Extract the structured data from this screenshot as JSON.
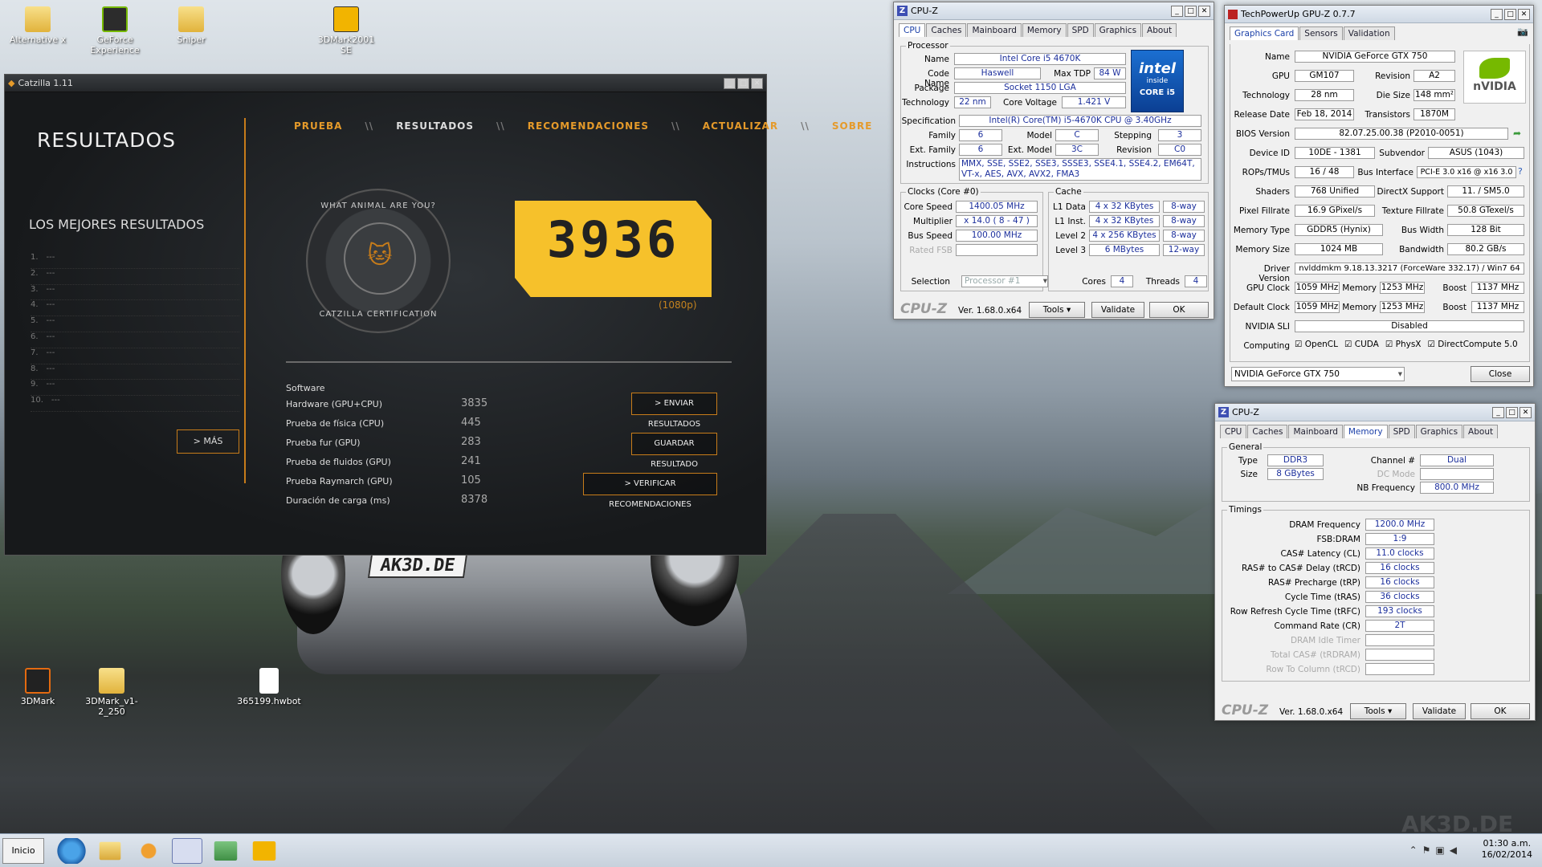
{
  "desktop": {
    "icons": [
      {
        "label": "Alternative x"
      },
      {
        "label": "GeForce Experience"
      },
      {
        "label": "Sniper"
      },
      {
        "label": "3DMark2001 SE"
      },
      {
        "label": "3DMark"
      },
      {
        "label": "3DMark_v1-2_250"
      },
      {
        "label": "365199.hwbot"
      }
    ],
    "plate": "AK3D.DE",
    "watermark": "AK3D.DE"
  },
  "catzilla": {
    "title": "Catzilla 1.11",
    "nav": [
      "PRUEBA",
      "RESULTADOS",
      "RECOMENDACIONES",
      "ACTUALIZAR",
      "SOBRE"
    ],
    "nav_sep": "\\\\",
    "heading": "RESULTADOS",
    "best": "LOS MEJORES RESULTADOS",
    "list": [
      "1.",
      "2.",
      "3.",
      "4.",
      "5.",
      "6.",
      "7.",
      "8.",
      "9.",
      "10."
    ],
    "list_empty": "---",
    "more": "> MÁS",
    "badge_top": "WHAT ANIMAL ARE YOU?",
    "badge_bottom": "CATZILLA CERTIFICATION",
    "score": "3936",
    "resolution": "(1080p)",
    "software": "Software",
    "results": [
      {
        "label": "Hardware (GPU+CPU)",
        "value": "3835"
      },
      {
        "label": "Prueba de física (CPU)",
        "value": "445"
      },
      {
        "label": "Prueba fur (GPU)",
        "value": "283"
      },
      {
        "label": "Prueba de fluidos (GPU)",
        "value": "241"
      },
      {
        "label": "Prueba Raymarch (GPU)",
        "value": "105"
      },
      {
        "label": "Duración de carga (ms)",
        "value": "8378"
      }
    ],
    "btn_send": "> ENVIAR RESULTADOS",
    "btn_save": "GUARDAR RESULTADO",
    "btn_verify": "> VERIFICAR RECOMENDACIONES"
  },
  "cpuz1": {
    "title": "CPU-Z",
    "tabs": [
      "CPU",
      "Caches",
      "Mainboard",
      "Memory",
      "SPD",
      "Graphics",
      "About"
    ],
    "processor": "Processor",
    "name_l": "Name",
    "name": "Intel Core i5 4670K",
    "code_l": "Code Name",
    "code": "Haswell",
    "tdp_l": "Max TDP",
    "tdp": "84 W",
    "pkg_l": "Package",
    "pkg": "Socket 1150 LGA",
    "tech_l": "Technology",
    "tech": "22 nm",
    "volt_l": "Core Voltage",
    "volt": "1.421 V",
    "spec_l": "Specification",
    "spec": "Intel(R) Core(TM) i5-4670K CPU @ 3.40GHz",
    "fam_l": "Family",
    "fam": "6",
    "model_l": "Model",
    "model": "C",
    "step_l": "Stepping",
    "step": "3",
    "efam_l": "Ext. Family",
    "efam": "6",
    "emodel_l": "Ext. Model",
    "emodel": "3C",
    "rev_l": "Revision",
    "rev": "C0",
    "inst_l": "Instructions",
    "inst": "MMX, SSE, SSE2, SSE3, SSSE3, SSE4.1, SSE4.2, EM64T, VT-x, AES, AVX, AVX2, FMA3",
    "intel_logo": [
      "intel",
      "inside",
      "CORE i5"
    ],
    "clocks": "Clocks (Core #0)",
    "cs_l": "Core Speed",
    "cs": "1400.05 MHz",
    "mul_l": "Multiplier",
    "mul": "x 14.0 ( 8 - 47 )",
    "bus_l": "Bus Speed",
    "bus": "100.00 MHz",
    "fsb_l": "Rated FSB",
    "cache": "Cache",
    "l1d_l": "L1 Data",
    "l1d": "4 x 32 KBytes",
    "l1d_w": "8-way",
    "l1i_l": "L1 Inst.",
    "l1i": "4 x 32 KBytes",
    "l1i_w": "8-way",
    "l2_l": "Level 2",
    "l2": "4 x 256 KBytes",
    "l2_w": "8-way",
    "l3_l": "Level 3",
    "l3": "6 MBytes",
    "l3_w": "12-way",
    "sel_l": "Selection",
    "sel": "Processor #1",
    "cores_l": "Cores",
    "cores": "4",
    "thr_l": "Threads",
    "thr": "4",
    "logo": "CPU-Z",
    "ver": "Ver. 1.68.0.x64",
    "tools": "Tools",
    "validate": "Validate",
    "ok": "OK"
  },
  "gpuz": {
    "title": "TechPowerUp GPU-Z 0.7.7",
    "tabs": [
      "Graphics Card",
      "Sensors",
      "Validation"
    ],
    "rows": {
      "name_l": "Name",
      "name": "NVIDIA GeForce GTX 750",
      "gpu_l": "GPU",
      "gpu": "GM107",
      "rev_l": "Revision",
      "rev": "A2",
      "tech_l": "Technology",
      "tech": "28 nm",
      "die_l": "Die Size",
      "die": "148 mm²",
      "rel_l": "Release Date",
      "rel": "Feb 18, 2014",
      "tr_l": "Transistors",
      "tr": "1870M",
      "bios_l": "BIOS Version",
      "bios": "82.07.25.00.38 (P2010-0051)",
      "dev_l": "Device ID",
      "dev": "10DE - 1381",
      "sub_l": "Subvendor",
      "sub": "ASUS (1043)",
      "rops_l": "ROPs/TMUs",
      "rops": "16 / 48",
      "busi_l": "Bus Interface",
      "busi": "PCI-E 3.0 x16 @ x16 3.0",
      "sh_l": "Shaders",
      "sh": "768 Unified",
      "dx_l": "DirectX Support",
      "dx": "11. / SM5.0",
      "pf_l": "Pixel Fillrate",
      "pf": "16.9 GPixel/s",
      "tf_l": "Texture Fillrate",
      "tf": "50.8 GTexel/s",
      "mt_l": "Memory Type",
      "mt": "GDDR5 (Hynix)",
      "bw_l": "Bus Width",
      "bw": "128 Bit",
      "ms_l": "Memory Size",
      "ms": "1024 MB",
      "band_l": "Bandwidth",
      "band": "80.2 GB/s",
      "drv_l": "Driver Version",
      "drv": "nvlddmkm 9.18.13.3217 (ForceWare 332.17) / Win7 64",
      "gc_l": "GPU Clock",
      "gc": "1059 MHz",
      "mem_l": "Memory",
      "gm": "1253 MHz",
      "boost_l": "Boost",
      "gb": "1137 MHz",
      "dc_l": "Default Clock",
      "dc": "1059 MHz",
      "dm": "1253 MHz",
      "db": "1137 MHz",
      "sli_l": "NVIDIA SLI",
      "sli": "Disabled",
      "comp_l": "Computing",
      "opencl": "OpenCL",
      "cuda": "CUDA",
      "physx": "PhysX",
      "dcomp": "DirectCompute 5.0"
    },
    "select": "NVIDIA GeForce GTX 750",
    "close": "Close",
    "nvidia": "nVIDIA"
  },
  "cpuz2": {
    "title": "CPU-Z",
    "tabs": [
      "CPU",
      "Caches",
      "Mainboard",
      "Memory",
      "SPD",
      "Graphics",
      "About"
    ],
    "general": "General",
    "type_l": "Type",
    "type": "DDR3",
    "ch_l": "Channel #",
    "ch": "Dual",
    "size_l": "Size",
    "size": "8 GBytes",
    "dc_l": "DC Mode",
    "nb_l": "NB Frequency",
    "nb": "800.0 MHz",
    "timings": "Timings",
    "t": [
      {
        "l": "DRAM Frequency",
        "v": "1200.0 MHz"
      },
      {
        "l": "FSB:DRAM",
        "v": "1:9"
      },
      {
        "l": "CAS# Latency (CL)",
        "v": "11.0 clocks"
      },
      {
        "l": "RAS# to CAS# Delay (tRCD)",
        "v": "16 clocks"
      },
      {
        "l": "RAS# Precharge (tRP)",
        "v": "16 clocks"
      },
      {
        "l": "Cycle Time (tRAS)",
        "v": "36 clocks"
      },
      {
        "l": "Row Refresh Cycle Time (tRFC)",
        "v": "193 clocks"
      },
      {
        "l": "Command Rate (CR)",
        "v": "2T"
      },
      {
        "l": "DRAM Idle Timer",
        "v": ""
      },
      {
        "l": "Total CAS# (tRDRAM)",
        "v": ""
      },
      {
        "l": "Row To Column (tRCD)",
        "v": ""
      }
    ],
    "logo": "CPU-Z",
    "ver": "Ver. 1.68.0.x64",
    "tools": "Tools",
    "validate": "Validate",
    "ok": "OK"
  },
  "taskbar": {
    "start": "Inicio",
    "time": "01:30 a.m.",
    "date": "16/02/2014"
  }
}
